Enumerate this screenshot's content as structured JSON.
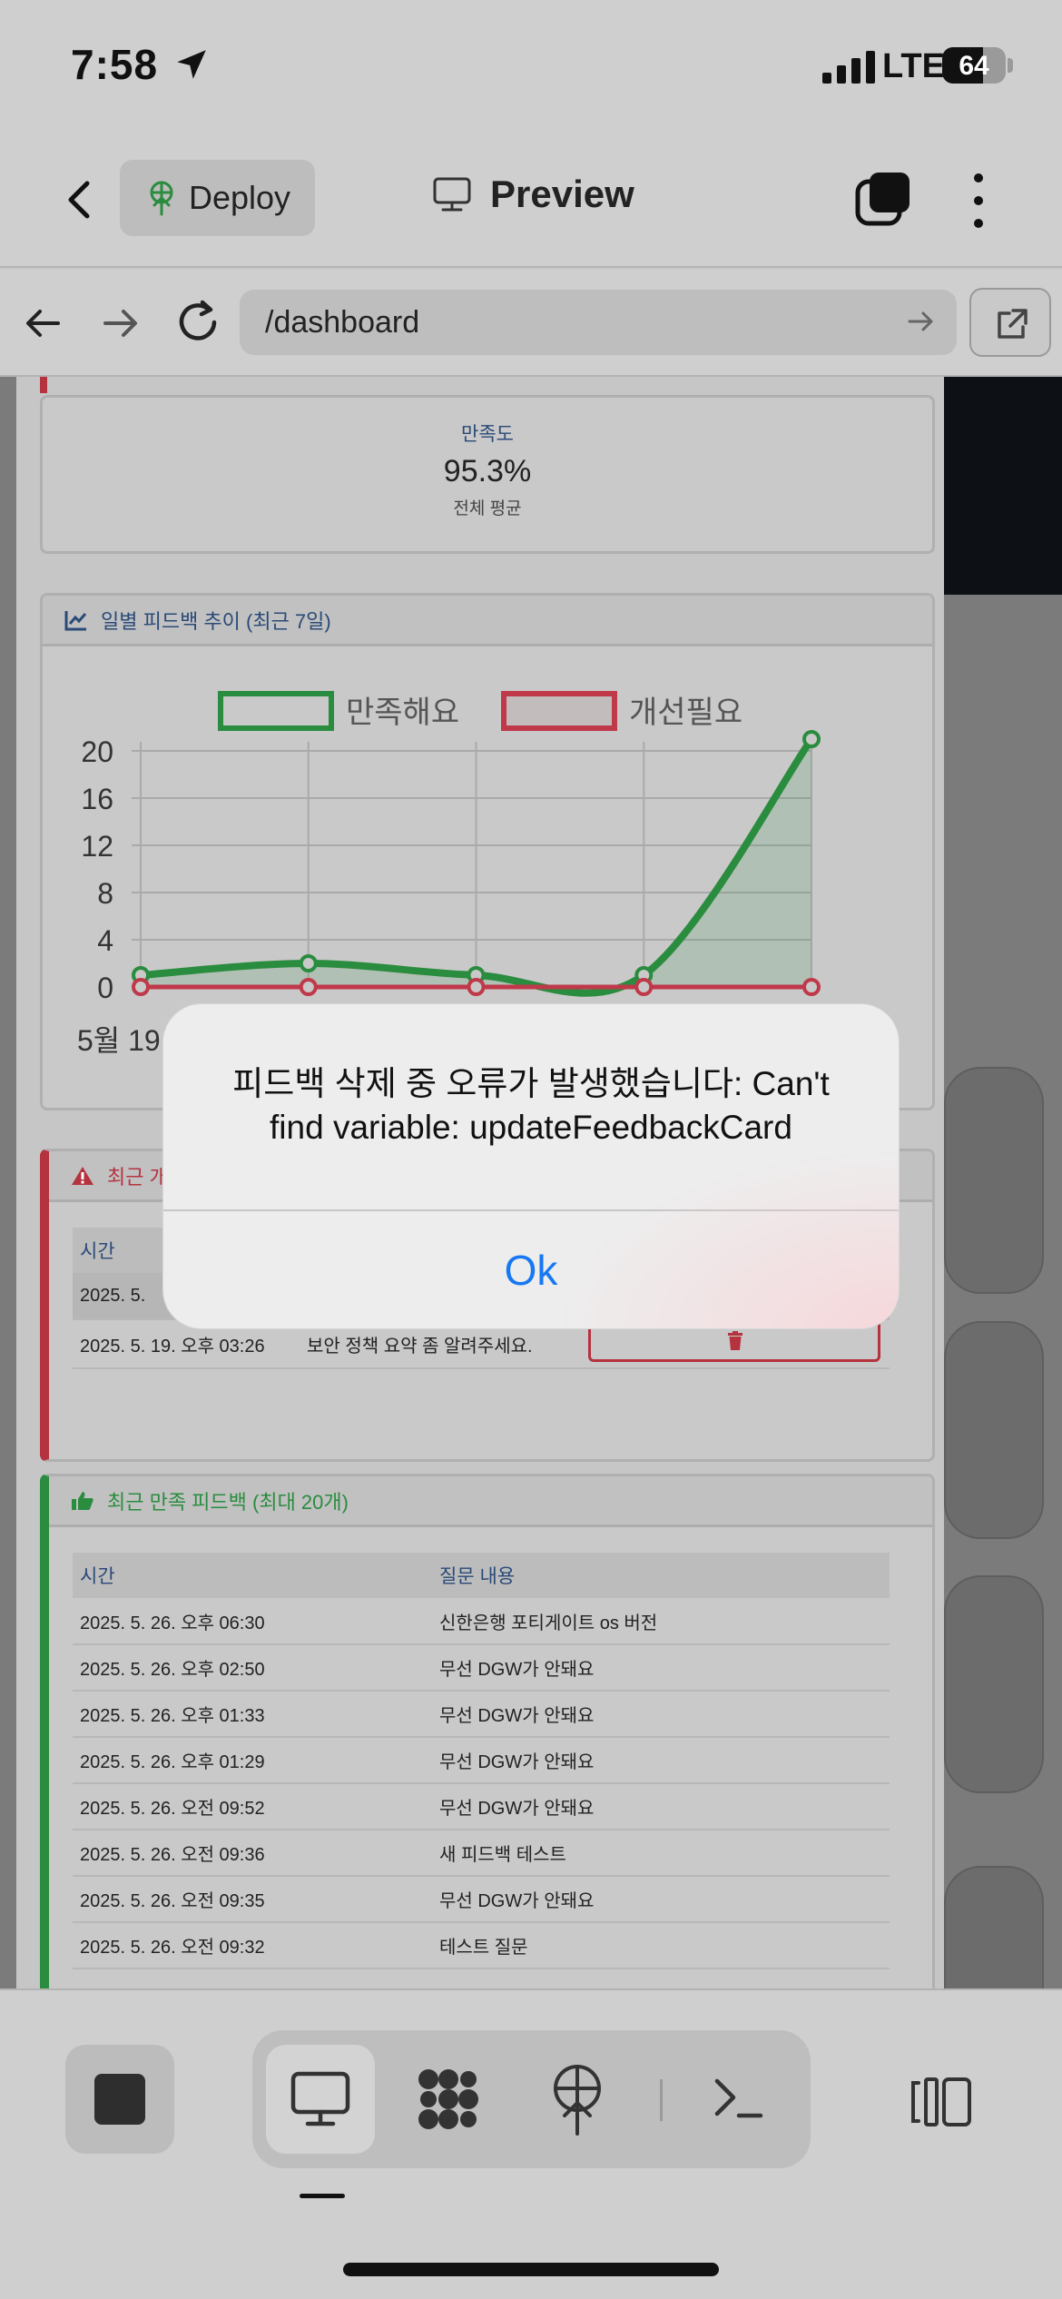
{
  "status_bar": {
    "time": "7:58",
    "network": "LTE",
    "battery": "64",
    "battery_level": 0.64
  },
  "app_bar": {
    "deploy_label": "Deploy",
    "preview_label": "Preview"
  },
  "url_bar": {
    "path": "/dashboard"
  },
  "satisfaction": {
    "label": "만족도",
    "value": "95.3%",
    "sub": "전체 평균"
  },
  "chart_section": {
    "header": "일별 피드백 추이 (최근 7일)",
    "x_first_label": "5월 19"
  },
  "chart_data": {
    "type": "line",
    "ylim": [
      0,
      20
    ],
    "y_ticks": [
      "20",
      "16",
      "12",
      "8",
      "4",
      "0"
    ],
    "x_categories": [
      "5월 19",
      "",
      "",
      "",
      ""
    ],
    "series": [
      {
        "name": "만족해요",
        "color": "#2a8c3e",
        "values": [
          1,
          2,
          1,
          1,
          21
        ]
      },
      {
        "name": "개선필요",
        "color": "#c0394a",
        "values": [
          0,
          0,
          0,
          0,
          0
        ]
      }
    ],
    "legend_position": "top",
    "grid": true
  },
  "negative_section": {
    "header": "최근 개",
    "col_time": "시간",
    "rows": [
      {
        "time": "2025. 5.",
        "question": ""
      },
      {
        "time": "2025. 5. 19. 오후 03:26",
        "question": "보안 정책 요약 좀 알려주세요."
      }
    ]
  },
  "positive_section": {
    "header": "최근 만족 피드백 (최대 20개)",
    "col_time": "시간",
    "col_question": "질문 내용",
    "rows": [
      {
        "time": "2025. 5. 26. 오후 06:30",
        "question": "신한은행 포티게이트 os 버전"
      },
      {
        "time": "2025. 5. 26. 오후 02:50",
        "question": "무선 DGW가 안돼요"
      },
      {
        "time": "2025. 5. 26. 오후 01:33",
        "question": "무선 DGW가 안돼요"
      },
      {
        "time": "2025. 5. 26. 오후 01:29",
        "question": "무선 DGW가 안돼요"
      },
      {
        "time": "2025. 5. 26. 오전 09:52",
        "question": "무선 DGW가 안돼요"
      },
      {
        "time": "2025. 5. 26. 오전 09:36",
        "question": "새 피드백 테스트"
      },
      {
        "time": "2025. 5. 26. 오전 09:35",
        "question": "무선 DGW가 안돼요"
      },
      {
        "time": "2025. 5. 26. 오전 09:32",
        "question": "테스트 질문"
      },
      {
        "time": "",
        "question": ""
      }
    ]
  },
  "alert": {
    "message": "피드백 삭제 중 오류가 발생했습니다: Can't find variable: updateFeedbackCard",
    "ok_label": "Ok"
  },
  "colors": {
    "accent_blue": "#1778f2",
    "danger": "#b5323f",
    "success": "#2a8c3e"
  }
}
